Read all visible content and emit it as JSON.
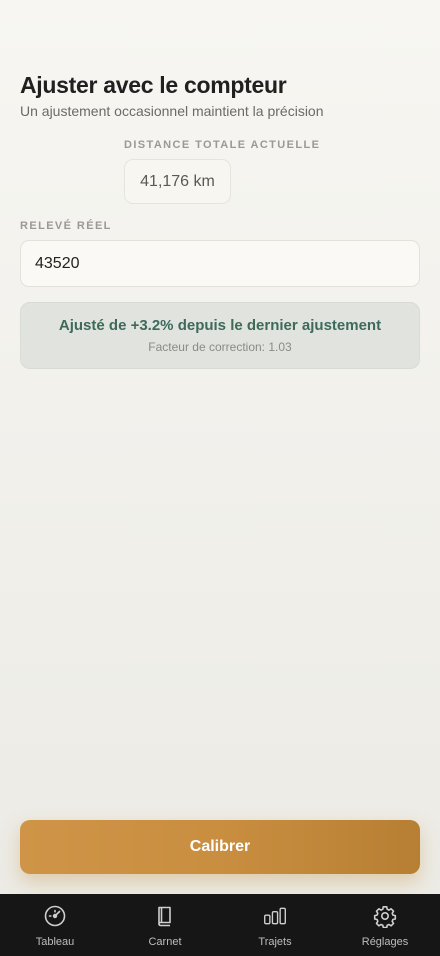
{
  "header": {
    "title": "Ajuster avec le compteur",
    "subtitle": "Un ajustement occasionnel maintient la précision"
  },
  "total": {
    "label": "DISTANCE TOTALE ACTUELLE",
    "value": "41,176 km"
  },
  "reading": {
    "label": "RELEVÉ RÉEL",
    "value": "43520"
  },
  "status": {
    "main": "Ajusté de +3.2% depuis le dernier ajustement",
    "sub": "Facteur de correction: 1.03",
    "color": "#3e6a5c"
  },
  "action": {
    "calibrate_label": "Calibrer",
    "accent": "#c98e40"
  },
  "tabbar": {
    "items": [
      {
        "label": "Tableau",
        "icon": "gauge-icon"
      },
      {
        "label": "Carnet",
        "icon": "book-icon"
      },
      {
        "label": "Trajets",
        "icon": "bar-chart-icon"
      },
      {
        "label": "Réglages",
        "icon": "gear-icon"
      }
    ]
  }
}
